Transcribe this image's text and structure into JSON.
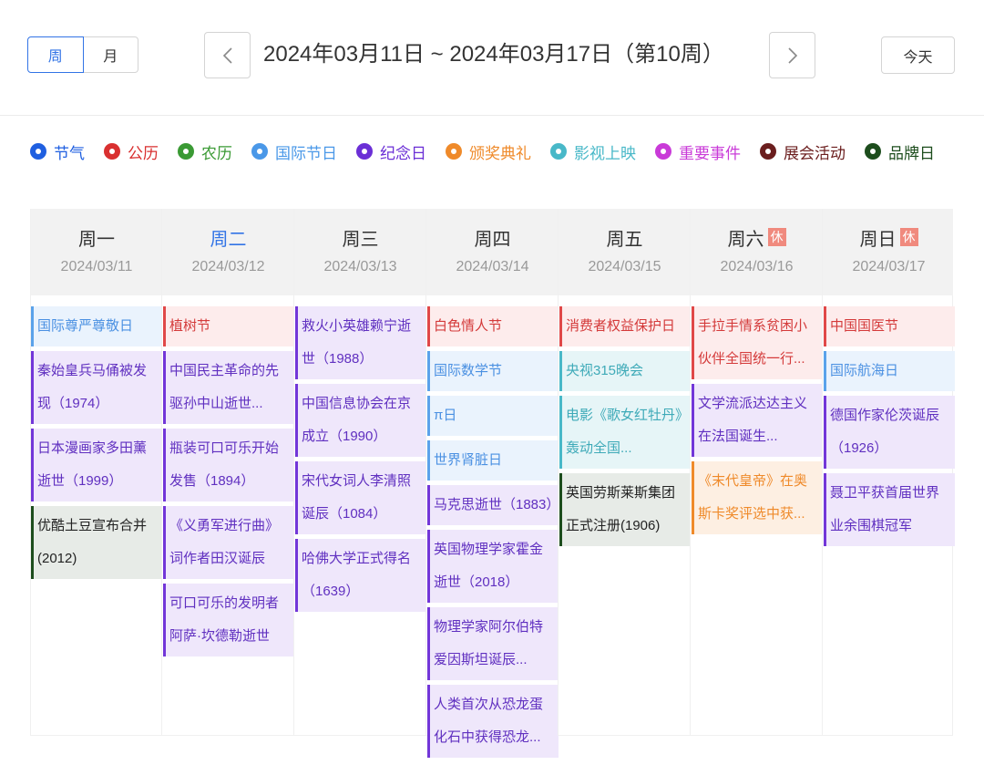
{
  "view_toggle": {
    "week": "周",
    "month": "月"
  },
  "range_title": "2024年03月11日 ~ 2024年03月17日（第10周）",
  "today_label": "今天",
  "legend": [
    {
      "label": "节气",
      "color": "#1f5fe0"
    },
    {
      "label": "公历",
      "color": "#d93030"
    },
    {
      "label": "农历",
      "color": "#3a9a34"
    },
    {
      "label": "国际节日",
      "color": "#4a98e8"
    },
    {
      "label": "纪念日",
      "color": "#6b2fd6"
    },
    {
      "label": "颁奖典礼",
      "color": "#ef8a2a"
    },
    {
      "label": "影视上映",
      "color": "#48b8c8"
    },
    {
      "label": "重要事件",
      "color": "#c93ad8"
    },
    {
      "label": "展会活动",
      "color": "#6b1e1e"
    },
    {
      "label": "品牌日",
      "color": "#1d4d1d"
    }
  ],
  "rest_label": "休",
  "days": [
    {
      "name": "周一",
      "date": "2024/03/11",
      "today": false,
      "rest": false,
      "events": [
        {
          "text": "国际尊严尊敬日",
          "type": "intl"
        },
        {
          "text": "秦始皇兵马俑被发现（1974）",
          "type": "memorial"
        },
        {
          "text": "日本漫画家多田薰逝世（1999）",
          "type": "memorial"
        },
        {
          "text": "优酷土豆宣布合并(2012)",
          "type": "brand"
        }
      ]
    },
    {
      "name": "周二",
      "date": "2024/03/12",
      "today": true,
      "rest": false,
      "events": [
        {
          "text": "植树节",
          "type": "gregorian"
        },
        {
          "text": "中国民主革命的先驱孙中山逝世...",
          "type": "memorial"
        },
        {
          "text": "瓶装可口可乐开始发售（1894）",
          "type": "memorial"
        },
        {
          "text": "《义勇军进行曲》词作者田汉诞辰",
          "type": "memorial"
        },
        {
          "text": "可口可乐的发明者阿萨·坎德勒逝世",
          "type": "memorial"
        }
      ]
    },
    {
      "name": "周三",
      "date": "2024/03/13",
      "today": false,
      "rest": false,
      "events": [
        {
          "text": "救火小英雄赖宁逝世（1988）",
          "type": "memorial"
        },
        {
          "text": "中国信息协会在京成立（1990）",
          "type": "memorial"
        },
        {
          "text": "宋代女词人李清照诞辰（1084）",
          "type": "memorial"
        },
        {
          "text": "哈佛大学正式得名（1639）",
          "type": "memorial"
        }
      ]
    },
    {
      "name": "周四",
      "date": "2024/03/14",
      "today": false,
      "rest": false,
      "events": [
        {
          "text": "白色情人节",
          "type": "gregorian"
        },
        {
          "text": "国际数学节",
          "type": "intl"
        },
        {
          "text": "π日",
          "type": "intl"
        },
        {
          "text": "世界肾脏日",
          "type": "intl"
        },
        {
          "text": "马克思逝世（1883）",
          "type": "memorial"
        },
        {
          "text": "英国物理学家霍金逝世（2018）",
          "type": "memorial"
        },
        {
          "text": "物理学家阿尔伯特爱因斯坦诞辰...",
          "type": "memorial"
        },
        {
          "text": "人类首次从恐龙蛋化石中获得恐龙...",
          "type": "memorial"
        }
      ]
    },
    {
      "name": "周五",
      "date": "2024/03/15",
      "today": false,
      "rest": false,
      "events": [
        {
          "text": "消费者权益保护日",
          "type": "gregorian"
        },
        {
          "text": "央视315晚会",
          "type": "movie"
        },
        {
          "text": "电影《歌女红牡丹》轰动全国...",
          "type": "movie"
        },
        {
          "text": "英国劳斯莱斯集团正式注册(1906)",
          "type": "brand"
        }
      ]
    },
    {
      "name": "周六",
      "date": "2024/03/16",
      "today": false,
      "rest": true,
      "events": [
        {
          "text": "手拉手情系贫困小伙伴全国统一行...",
          "type": "gregorian"
        },
        {
          "text": "文学流派达达主义在法国诞生...",
          "type": "memorial"
        },
        {
          "text": "《末代皇帝》在奥斯卡奖评选中获...",
          "type": "award"
        }
      ]
    },
    {
      "name": "周日",
      "date": "2024/03/17",
      "today": false,
      "rest": true,
      "events": [
        {
          "text": "中国国医节",
          "type": "gregorian"
        },
        {
          "text": "国际航海日",
          "type": "intl"
        },
        {
          "text": "德国作家伦茨诞辰（1926）",
          "type": "memorial"
        },
        {
          "text": "聂卫平获首届世界业余围棋冠军",
          "type": "memorial"
        }
      ]
    }
  ],
  "event_styles": {
    "intl": {
      "border": "#5aa2ea",
      "bg": "#eaf3fd",
      "color": "#4a90e2"
    },
    "gregorian": {
      "border": "#e04848",
      "bg": "#fdecec",
      "color": "#d43a3a"
    },
    "memorial": {
      "border": "#7236d8",
      "bg": "#efe7fb",
      "color": "#6030c0"
    },
    "brand": {
      "border": "#1d4d1d",
      "bg": "#e7ebe7",
      "color": "#222222"
    },
    "movie": {
      "border": "#48b8c8",
      "bg": "#e6f5f7",
      "color": "#3eaab8"
    },
    "award": {
      "border": "#ef8a2a",
      "bg": "#fdefe2",
      "color": "#ef8a2a"
    }
  }
}
